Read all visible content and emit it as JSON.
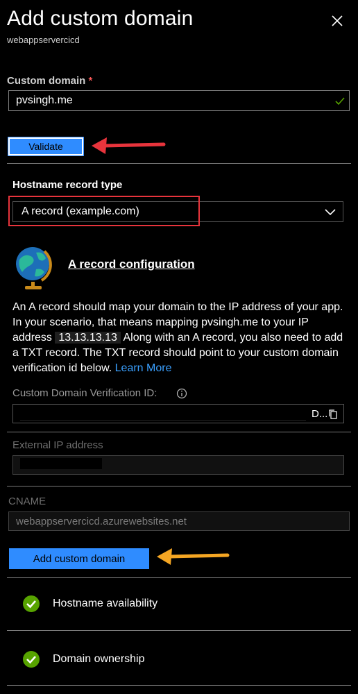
{
  "header": {
    "title": "Add custom domain",
    "subtitle": "webappservercicd",
    "close_icon": "close-icon"
  },
  "custom_domain": {
    "label": "Custom domain",
    "required_mark": "*",
    "value": "pvsingh.me",
    "valid_icon": "checkmark-icon"
  },
  "validate_button": "Validate",
  "record_type": {
    "label": "Hostname record type",
    "selected": "A record (example.com)"
  },
  "a_record": {
    "heading": "A record configuration",
    "icon": "globe-icon",
    "paragraph_part1": "An A record should map your domain to the IP address of your app. In your scenario, that means mapping pvsingh.me to your IP address ",
    "ip": "13.13.13.13",
    "paragraph_part2": " Along with an A record, you also need to add a TXT record. The TXT record should point to your custom domain verification id below. ",
    "learn_more": "Learn More"
  },
  "verification": {
    "label": "Custom Domain Verification ID:",
    "info_icon": "info-icon",
    "visible_suffix": "D...",
    "copy_icon": "copy-icon"
  },
  "external_ip": {
    "label": "External IP address"
  },
  "cname": {
    "label": "CNAME",
    "value": "webappservercicd.azurewebsites.net"
  },
  "add_button": "Add custom domain",
  "checks": [
    {
      "label": "Hostname availability",
      "status": "passed"
    },
    {
      "label": "Domain ownership",
      "status": "passed"
    }
  ],
  "colors": {
    "accent": "#2f8cff",
    "success": "#57a300",
    "annotation_red": "#e8343c",
    "annotation_orange": "#f5a623"
  }
}
